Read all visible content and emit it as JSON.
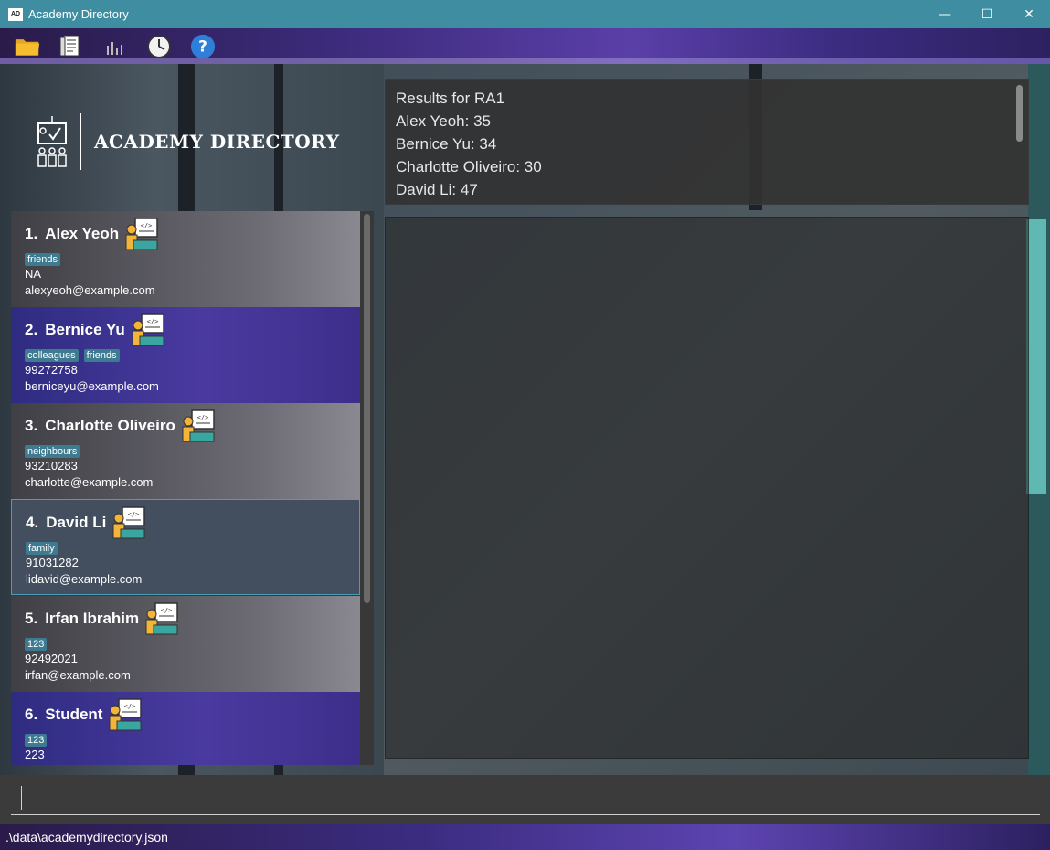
{
  "window": {
    "title": "Academy Directory",
    "icon_text": "AD",
    "minimize": "—",
    "maximize": "☐",
    "close": "✕"
  },
  "toolbar": {
    "items": [
      {
        "icon": "folder-icon"
      },
      {
        "icon": "document-icon"
      },
      {
        "icon": "bar-chart-icon"
      },
      {
        "icon": "clock-icon"
      },
      {
        "icon": "help-icon"
      }
    ]
  },
  "header": {
    "title": "ACADEMY DIRECTORY"
  },
  "result": {
    "lines": [
      "Results for RA1",
      "Alex Yeoh: 35",
      "Bernice Yu: 34",
      "Charlotte Oliveiro: 30",
      "David Li: 47"
    ]
  },
  "persons": [
    {
      "index": "1.",
      "name": "Alex Yeoh",
      "tags": [
        "friends"
      ],
      "phone": "NA",
      "email": "alexyeoh@example.com"
    },
    {
      "index": "2.",
      "name": "Bernice Yu",
      "tags": [
        "colleagues",
        "friends"
      ],
      "phone": "99272758",
      "email": "berniceyu@example.com"
    },
    {
      "index": "3.",
      "name": "Charlotte Oliveiro",
      "tags": [
        "neighbours"
      ],
      "phone": "93210283",
      "email": "charlotte@example.com"
    },
    {
      "index": "4.",
      "name": "David Li",
      "tags": [
        "family"
      ],
      "phone": "91031282",
      "email": "lidavid@example.com"
    },
    {
      "index": "5.",
      "name": "Irfan Ibrahim",
      "tags": [
        "123"
      ],
      "phone": "92492021",
      "email": "irfan@example.com"
    },
    {
      "index": "6.",
      "name": "Student",
      "tags": [
        "123"
      ],
      "phone": "223",
      "email": ""
    }
  ],
  "command": {
    "value": "",
    "placeholder": ""
  },
  "status": {
    "file_path": ".\\data\\academydirectory.json"
  },
  "colors": {
    "titlebar": "#3e8da0",
    "tag": "#3e7b91",
    "selected_border": "#4a9eb5"
  }
}
